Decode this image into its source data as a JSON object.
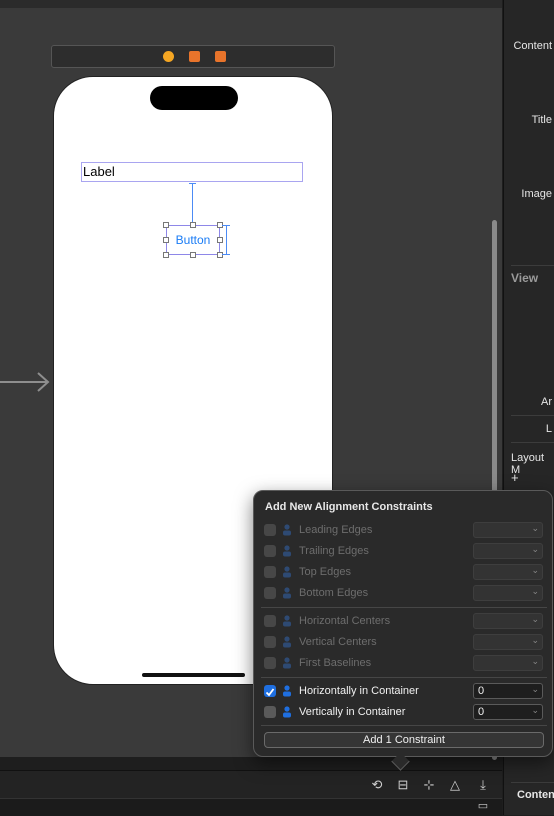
{
  "canvas": {
    "label_text": "Label",
    "button_text": "Button"
  },
  "inspector": {
    "content": "Content",
    "title": "Title",
    "image": "Image",
    "view_header": "View",
    "ar": "Ar",
    "l": "L",
    "layout_margins": "Layout M",
    "add": "+",
    "content_bottom": "Conten"
  },
  "popover": {
    "title": "Add New Alignment Constraints",
    "rows": [
      {
        "label": "Leading Edges",
        "checked": false,
        "enabled": false,
        "value": "",
        "icon": "leading-edges-icon"
      },
      {
        "label": "Trailing Edges",
        "checked": false,
        "enabled": false,
        "value": "",
        "icon": "trailing-edges-icon"
      },
      {
        "label": "Top Edges",
        "checked": false,
        "enabled": false,
        "value": "",
        "icon": "top-edges-icon"
      },
      {
        "label": "Bottom Edges",
        "checked": false,
        "enabled": false,
        "value": "",
        "icon": "bottom-edges-icon"
      },
      {
        "label": "Horizontal Centers",
        "checked": false,
        "enabled": false,
        "value": "",
        "icon": "horizontal-centers-icon"
      },
      {
        "label": "Vertical Centers",
        "checked": false,
        "enabled": false,
        "value": "",
        "icon": "vertical-centers-icon"
      },
      {
        "label": "First Baselines",
        "checked": false,
        "enabled": false,
        "value": "",
        "icon": "first-baselines-icon"
      },
      {
        "label": "Horizontally in Container",
        "checked": true,
        "enabled": true,
        "value": "0",
        "icon": "horizontally-in-container-icon"
      },
      {
        "label": "Vertically in Container",
        "checked": false,
        "enabled": true,
        "value": "0",
        "icon": "vertically-in-container-icon"
      }
    ],
    "add_button": "Add 1 Constraint"
  },
  "colors": {
    "accent": "#1f6fe0",
    "button_text": "#1a7cf5",
    "constraint_line": "#4c8bf5"
  }
}
